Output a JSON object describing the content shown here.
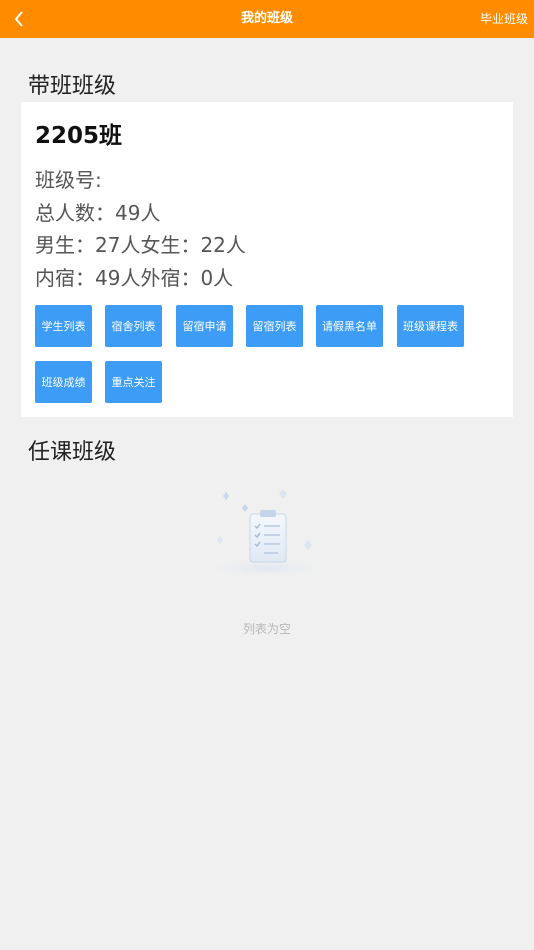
{
  "header": {
    "title": "我的班级",
    "right_link": "毕业班级",
    "background": "#ff8c00"
  },
  "sections": {
    "head_class_title": "带班班级",
    "teach_class_title": "任课班级"
  },
  "class_card": {
    "name": "2205班",
    "class_no": "班级号:",
    "total": "总人数：49人",
    "gender": "男生：27人女生：22人",
    "boarding": "内宿：49人外宿：0人",
    "buttons": [
      "学生列表",
      "宿舍列表",
      "留宿申请",
      "留宿列表",
      "请假黑名单",
      "班级课程表",
      "班级成绩",
      "重点关注"
    ],
    "button_color": "#3d9cf5"
  },
  "empty_state": {
    "text": "列表为空",
    "icon": "empty-clipboard-icon"
  }
}
